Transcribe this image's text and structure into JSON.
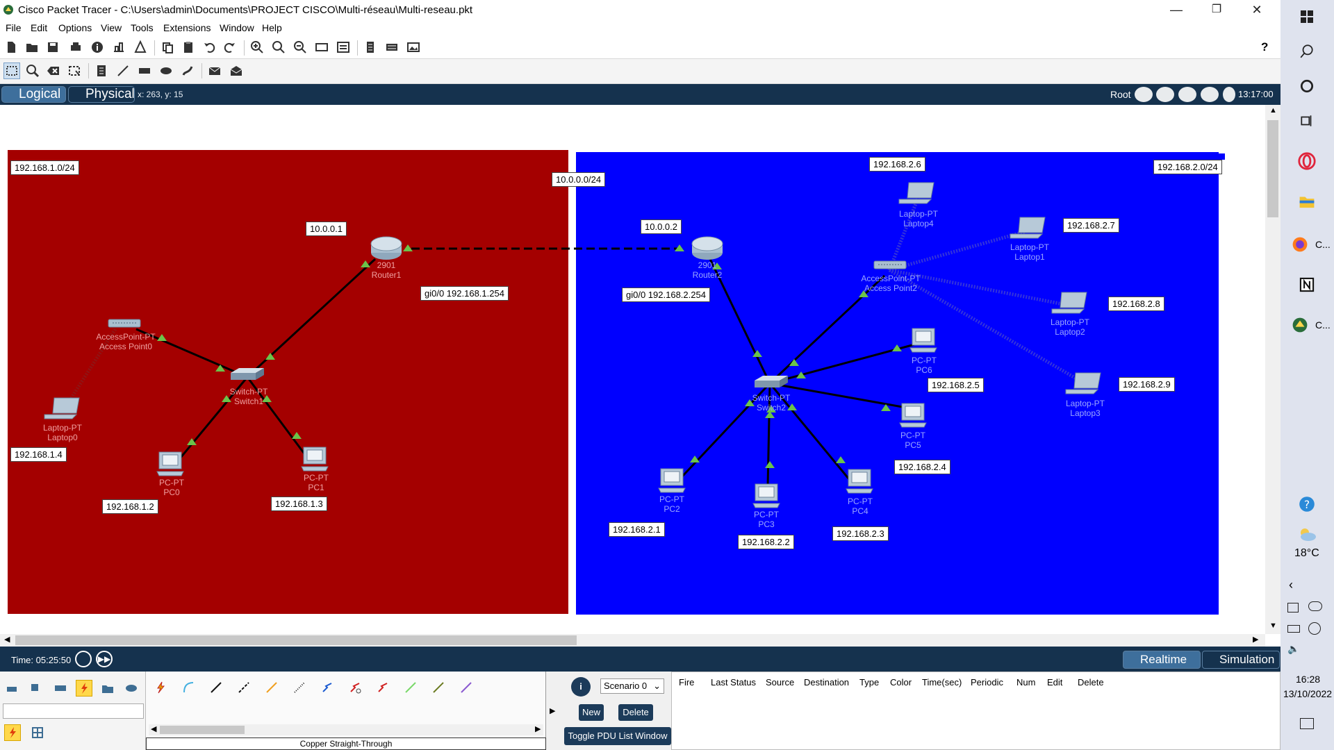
{
  "window": {
    "title": "Cisco Packet Tracer - C:\\Users\\admin\\Documents\\PROJECT CISCO\\Multi-réseau\\Multi-reseau.pkt",
    "minimize": "—",
    "maximize": "❐",
    "close": "✕"
  },
  "menu": [
    "File",
    "Edit",
    "Options",
    "View",
    "Tools",
    "Extensions",
    "Window",
    "Help"
  ],
  "toolbar": {
    "help": "?"
  },
  "logical_bar": {
    "logical_tab": "Logical",
    "physical_tab": "Physical",
    "coords": "x: 263, y: 15",
    "root": "Root",
    "clock": "13:17:00"
  },
  "network": {
    "red_zone": {
      "label": "192.168.1.0/24",
      "color": "#a40000"
    },
    "blue_zone": {
      "label": "192.168.2.0/24",
      "color": "#0000ff"
    },
    "wan_label": "10.0.0.0/24",
    "ip_labels": {
      "r1_wan": "10.0.0.1",
      "r2_wan": "10.0.0.2",
      "r1_lan": "gi0/0 192.168.1.254",
      "r2_lan": "gi0/0 192.168.2.254",
      "laptop0": "192.168.1.4",
      "pc0": "192.168.1.2",
      "pc1": "192.168.1.3",
      "laptop4": "192.168.2.6",
      "laptop1": "192.168.2.7",
      "laptop2": "192.168.2.8",
      "laptop3": "192.168.2.9",
      "pc6": "192.168.2.5",
      "pc5": "192.168.2.4",
      "pc2": "192.168.2.1",
      "pc3": "192.168.2.2",
      "pc4": "192.168.2.3"
    },
    "devices": {
      "router1": [
        "2901",
        "Router1"
      ],
      "router2": [
        "2901",
        "Router2"
      ],
      "switch1": [
        "Switch-PT",
        "Switch1"
      ],
      "switch2": [
        "Switch-PT",
        "Switch2"
      ],
      "ap0": [
        "AccessPoint-PT",
        "Access Point0"
      ],
      "ap2": [
        "AccessPoint-PT",
        "Access Point2"
      ],
      "laptop0": [
        "Laptop-PT",
        "Laptop0"
      ],
      "pc0": [
        "PC-PT",
        "PC0"
      ],
      "pc1": [
        "PC-PT",
        "PC1"
      ],
      "laptop4": [
        "Laptop-PT",
        "Laptop4"
      ],
      "laptop1": [
        "Laptop-PT",
        "Laptop1"
      ],
      "laptop2": [
        "Laptop-PT",
        "Laptop2"
      ],
      "laptop3": [
        "Laptop-PT",
        "Laptop3"
      ],
      "pc6": [
        "PC-PT",
        "PC6"
      ],
      "pc5": [
        "PC-PT",
        "PC5"
      ],
      "pc2": [
        "PC-PT",
        "PC2"
      ],
      "pc3": [
        "PC-PT",
        "PC3"
      ],
      "pc4": [
        "PC-PT",
        "PC4"
      ]
    }
  },
  "time_bar": {
    "time": "Time: 05:25:50",
    "realtime": "Realtime",
    "simulation": "Simulation"
  },
  "bottom": {
    "cable_name": "Copper Straight-Through",
    "scenario": "Scenario 0",
    "new_button": "New",
    "delete_button": "Delete",
    "toggle_pdu": "Toggle PDU List Window",
    "pdu_columns": [
      "Fire",
      "Last Status",
      "Source",
      "Destination",
      "Type",
      "Color",
      "Time(sec)",
      "Periodic",
      "Num",
      "Edit",
      "Delete"
    ]
  },
  "taskbar": {
    "app_label_1": "C...",
    "app_label_2": "C...",
    "weather": "18°C",
    "clock_time": "16:28",
    "clock_date": "13/10/2022"
  }
}
